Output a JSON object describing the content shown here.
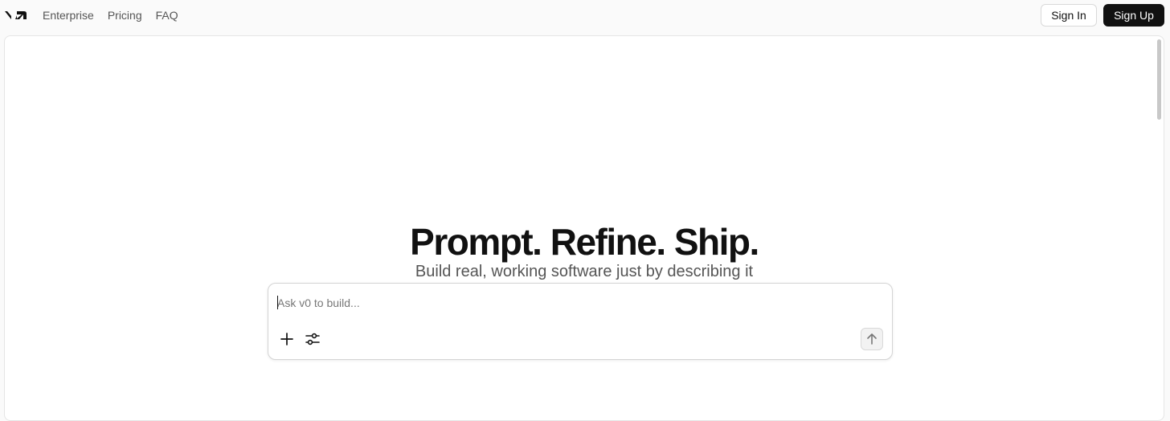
{
  "header": {
    "logo_icon": "v0-logo-icon",
    "nav": [
      {
        "label": "Enterprise"
      },
      {
        "label": "Pricing"
      },
      {
        "label": "FAQ"
      }
    ],
    "sign_in_label": "Sign In",
    "sign_up_label": "Sign Up"
  },
  "hero": {
    "title": "Prompt. Refine. Ship.",
    "subtitle": "Build real, working software just by describing it"
  },
  "composer": {
    "placeholder": "Ask v0 to build...",
    "value": "",
    "add_icon": "plus-icon",
    "settings_icon": "sliders-icon",
    "send_icon": "arrow-up-icon"
  },
  "colors": {
    "page_bg": "#fafafa",
    "panel_bg": "#ffffff",
    "primary_button": "#111111",
    "muted_text": "#555555"
  }
}
